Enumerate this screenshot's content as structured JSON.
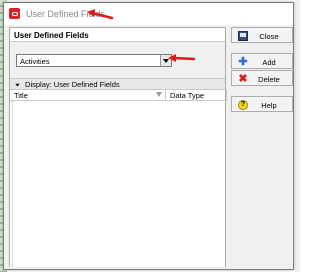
{
  "window": {
    "title": "User Defined Fields"
  },
  "panel": {
    "header": "User Defined Fields",
    "subject_select": {
      "value": "Activities"
    },
    "display_bar": "Display: User Defined Fields",
    "table": {
      "columns": [
        "Title",
        "Data Type"
      ],
      "rows": []
    }
  },
  "buttons": {
    "close": "Close",
    "add": "Add",
    "delete": "Delete",
    "help": "Help"
  },
  "icons": {
    "app": "app-logo-icon",
    "close": "close-window-icon",
    "add": "plus-icon",
    "delete": "x-icon",
    "help": "help-icon",
    "dropdown": "chevron-down-icon",
    "filter": "filter-icon",
    "annotation": "red-arrow-icon"
  },
  "colors": {
    "annotation_arrow": "#d91e18",
    "app_icon": "#d8232a",
    "add_icon": "#2a6fd6",
    "delete_icon": "#d32424",
    "help_icon": "#f2d51d"
  }
}
